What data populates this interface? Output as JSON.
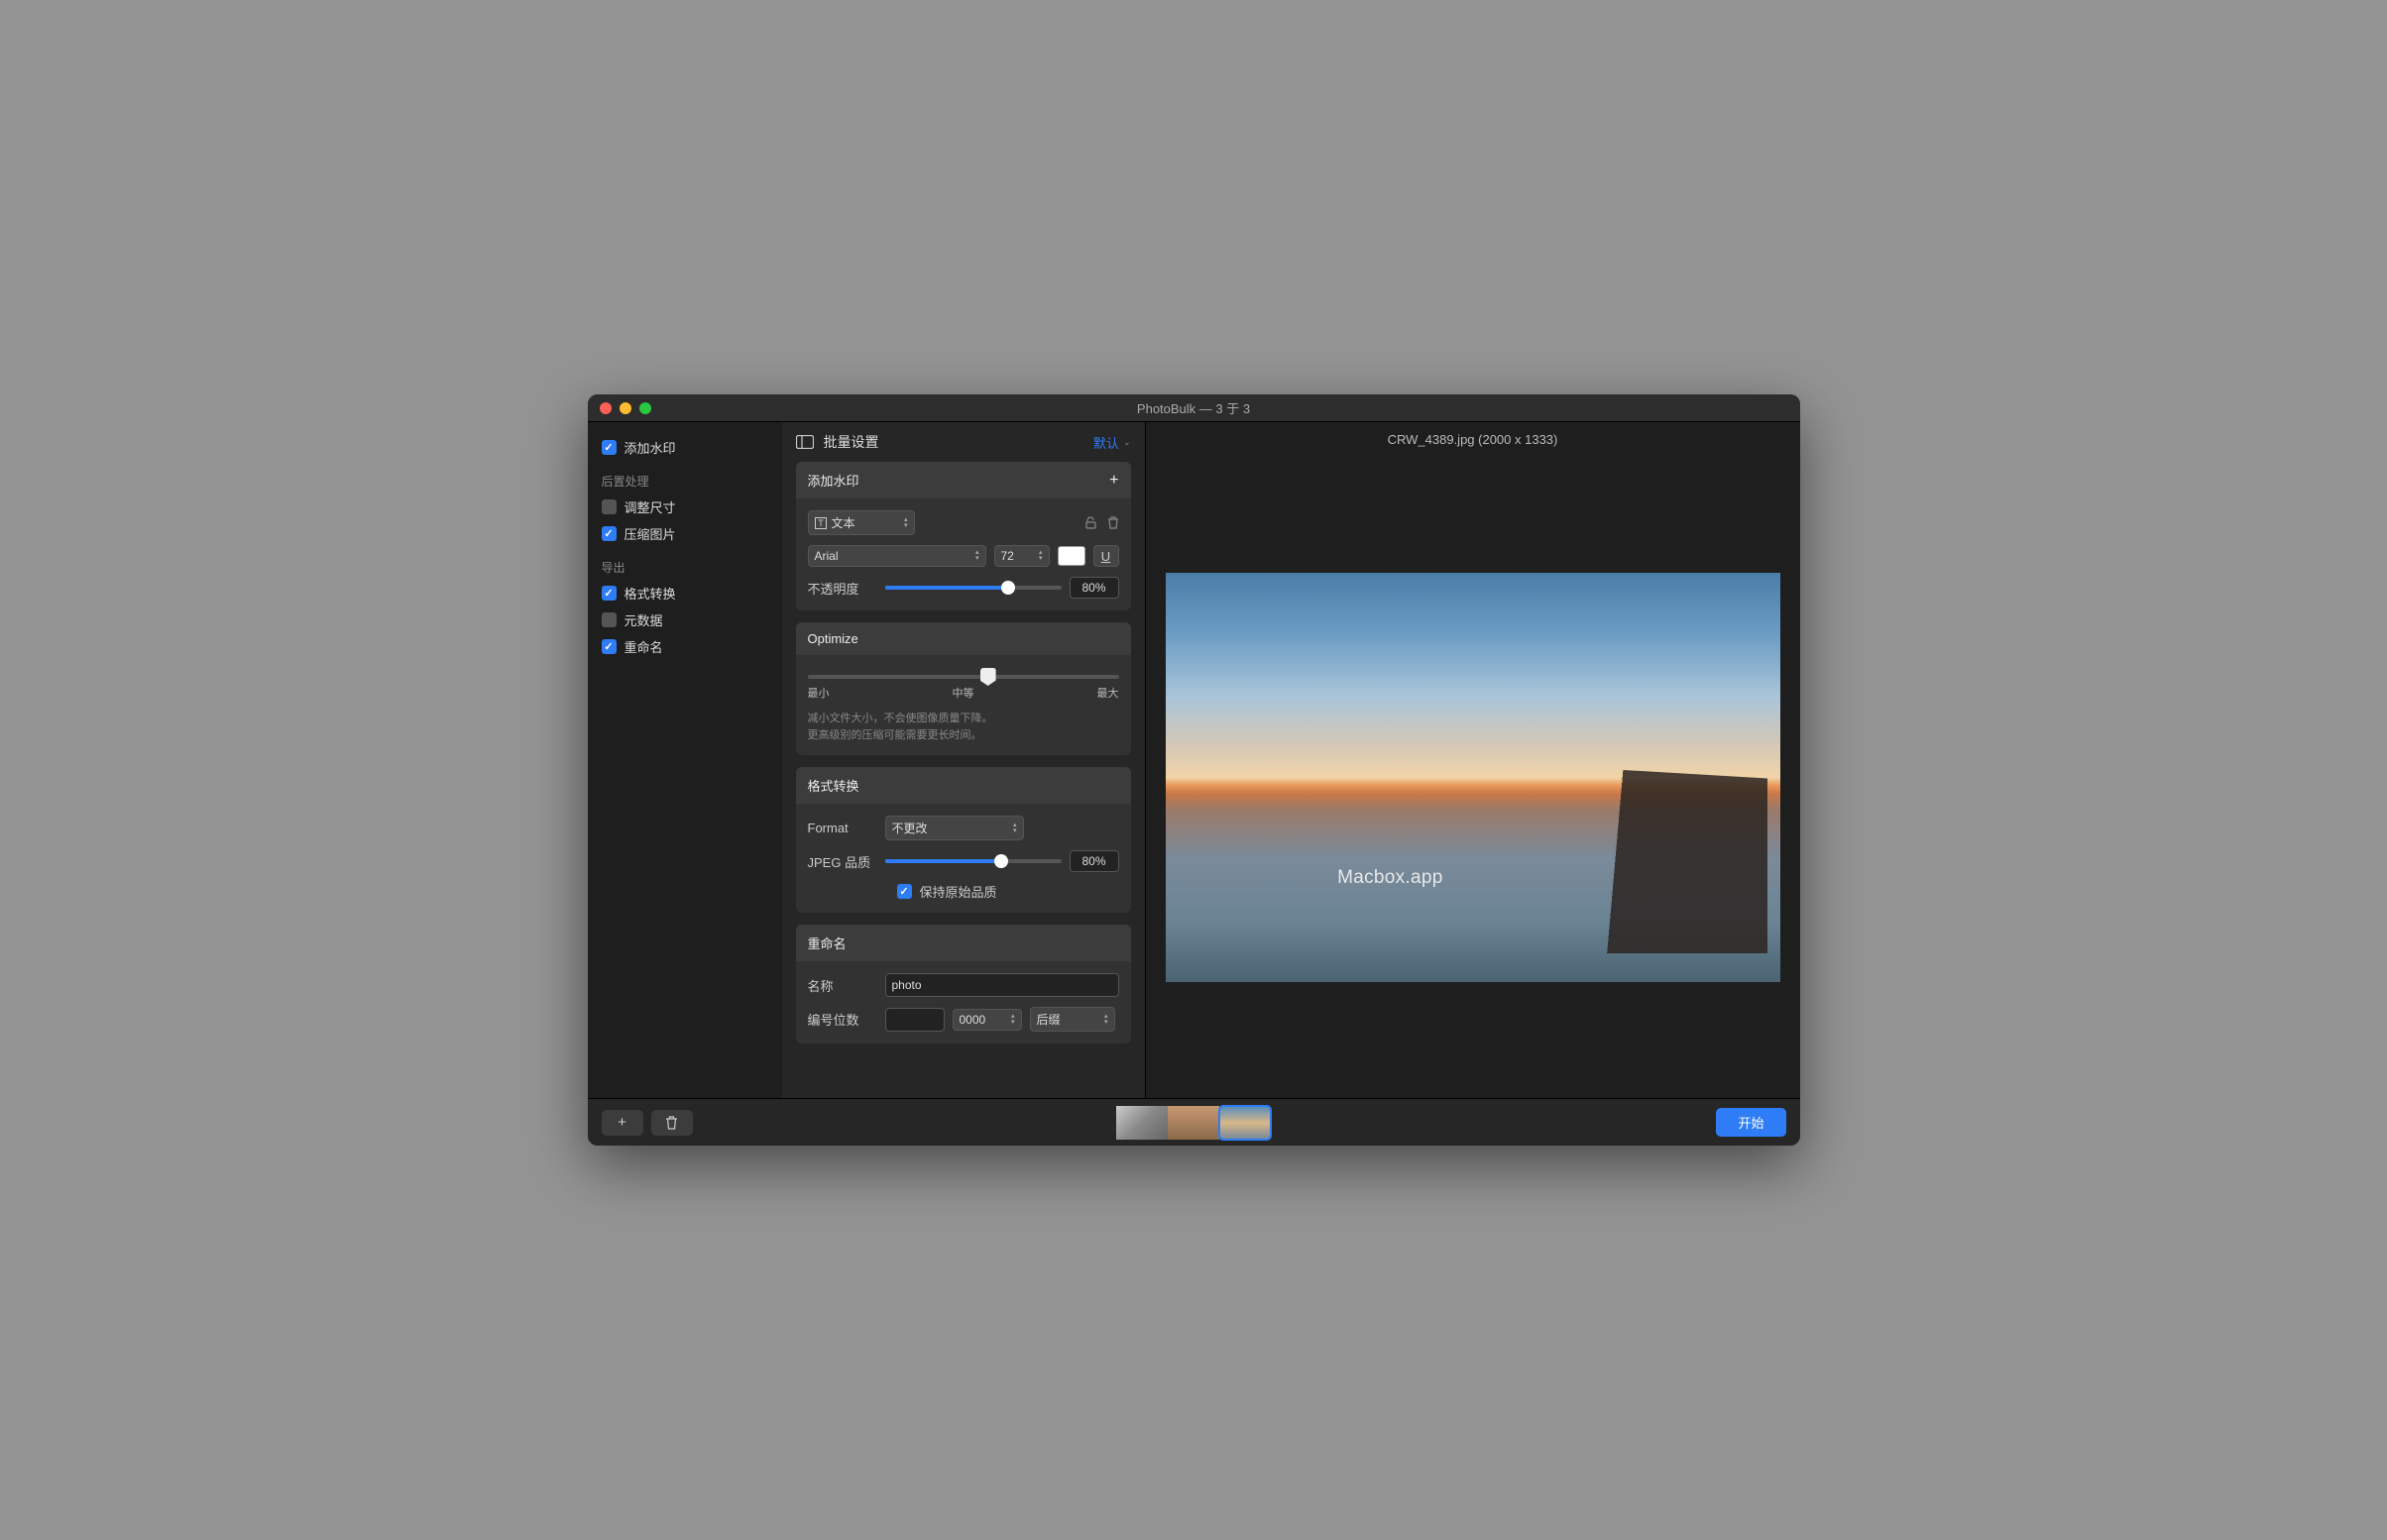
{
  "title": "PhotoBulk — 3 于 3",
  "sidebar": {
    "watermark": {
      "label": "添加水印",
      "checked": true
    },
    "postHeader": "后置处理",
    "resize": {
      "label": "调整尺寸",
      "checked": false
    },
    "compress": {
      "label": "压缩图片",
      "checked": true
    },
    "exportHeader": "导出",
    "format": {
      "label": "格式转换",
      "checked": true
    },
    "metadata": {
      "label": "元数据",
      "checked": false
    },
    "rename": {
      "label": "重命名",
      "checked": true
    }
  },
  "settings": {
    "header": "批量设置",
    "preset": "默认",
    "watermark": {
      "title": "添加水印",
      "type": "文本",
      "font": "Arial",
      "size": "72",
      "opacityLabel": "不透明度",
      "opacityPct": "80%",
      "opacityVal": 70
    },
    "optimize": {
      "title": "Optimize",
      "min": "最小",
      "mid": "中等",
      "max": "最大",
      "pos": 58,
      "desc1": "减小文件大小，不会使图像质量下降。",
      "desc2": "更高级别的压缩可能需要更长时间。"
    },
    "format": {
      "title": "格式转换",
      "formatLabel": "Format",
      "formatVal": "不更改",
      "qualityLabel": "JPEG 品质",
      "qualityPct": "80%",
      "qualityVal": 66,
      "keepOriginal": "保持原始品质"
    },
    "rename": {
      "title": "重命名",
      "nameLabel": "名称",
      "nameVal": "photo",
      "digitsLabel": "编号位数",
      "digitsFmt": "0000",
      "positionVal": "后缀"
    }
  },
  "preview": {
    "filename": "CRW_4389.jpg (2000 x 1333)",
    "watermarkText": "Macbox.app"
  },
  "footer": {
    "start": "开始"
  }
}
